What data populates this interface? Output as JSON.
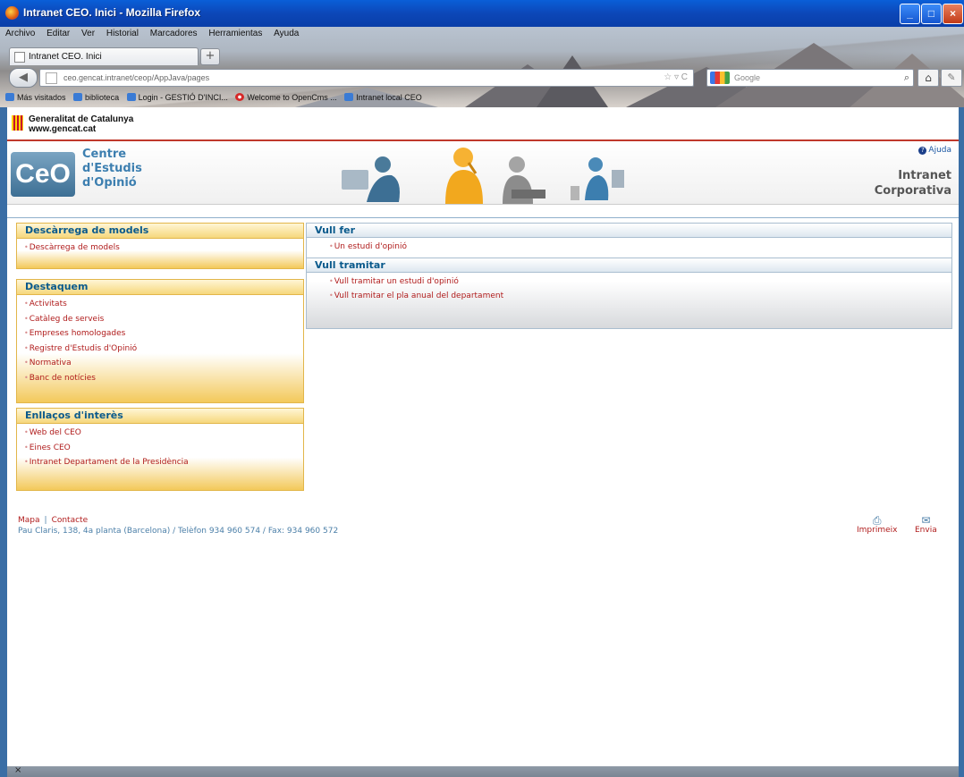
{
  "window": {
    "title": "Intranet CEO. Inici - Mozilla Firefox"
  },
  "browser": {
    "menu": [
      "Archivo",
      "Editar",
      "Ver",
      "Historial",
      "Marcadores",
      "Herramientas",
      "Ayuda"
    ],
    "tab_title": "Intranet CEO. Inici",
    "url": "ceo.gencat.intranet/ceop/AppJava/pages",
    "search_placeholder": "Google",
    "bookmarks": [
      "Más visitados",
      "biblioteca",
      "Login - GESTIÓ D'INCI...",
      "Welcome to OpenCms ...",
      "Intranet local CEO"
    ]
  },
  "header": {
    "org_line1": "Generalitat de Catalunya",
    "org_line2": "www.gencat.cat",
    "logo_text": "CeO",
    "ceo_line1": "Centre",
    "ceo_line2": "d'Estudis",
    "ceo_line3": "d'Opinió",
    "help": "Ajuda",
    "intranet_line1": "Intranet",
    "intranet_line2": "Corporativa"
  },
  "sidebar": {
    "descarrega": {
      "title": "Descàrrega de models",
      "items": [
        "Descàrrega de models"
      ]
    },
    "destaquem": {
      "title": "Destaquem",
      "items": [
        "Activitats",
        "Catàleg de serveis",
        "Empreses homologades",
        "Registre d'Estudis d'Opinió",
        "Normativa",
        "Banc de notícies"
      ]
    },
    "enllacos": {
      "title": "Enllaços d'interès",
      "items": [
        "Web del CEO",
        "Eines CEO",
        "Intranet Departament de la Presidència"
      ]
    }
  },
  "main": {
    "vull_fer": {
      "title": "Vull fer",
      "items": [
        "Un estudi d'opinió"
      ]
    },
    "vull_tramitar": {
      "title": "Vull tramitar",
      "items": [
        "Vull tramitar un estudi d'opinió",
        "Vull tramitar el pla anual del departament"
      ]
    }
  },
  "footer": {
    "mapa": "Mapa",
    "contacte": "Contacte",
    "address": "Pau Claris, 138, 4a planta (Barcelona) / Telèfon 934 960 574 / Fax: 934 960 572",
    "imprimeix": "Imprimeix",
    "envia": "Envia"
  },
  "statusbar": {
    "close": "×"
  }
}
